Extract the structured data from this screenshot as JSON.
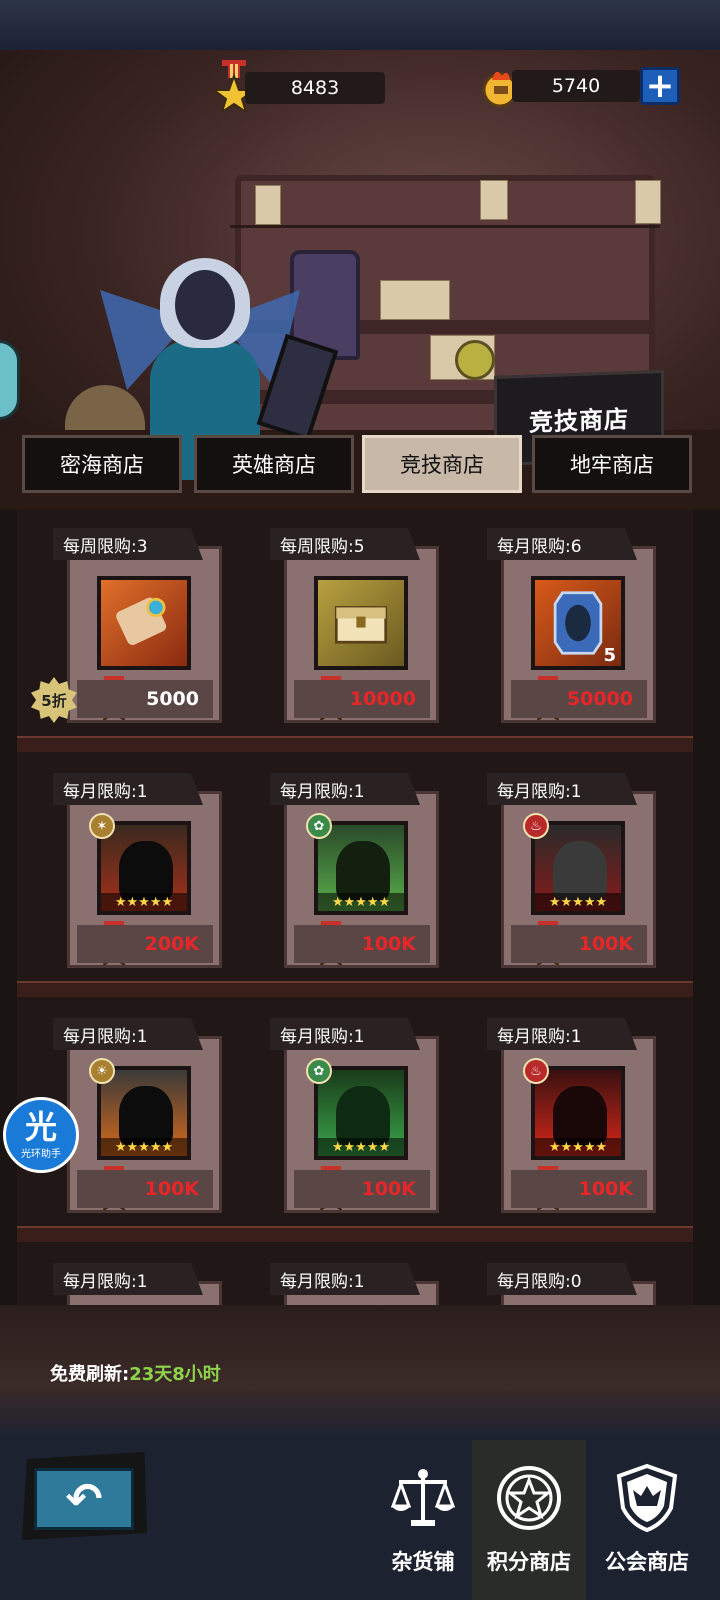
{
  "currency": {
    "medal_amount": "8483",
    "fire_amount": "5740",
    "plus_label": "+"
  },
  "shop_sign": "竞技商店",
  "tabs": [
    {
      "label": "密海商店",
      "active": false
    },
    {
      "label": "英雄商店",
      "active": false
    },
    {
      "label": "竞技商店",
      "active": true
    },
    {
      "label": "地牢商店",
      "active": false
    }
  ],
  "items": [
    {
      "limit": "每周限购:3",
      "price": "5000",
      "price_color": "white",
      "icon": "scroll-icon",
      "discount": "5折"
    },
    {
      "limit": "每周限购:5",
      "price": "10000",
      "price_color": "red",
      "icon": "treasure-chest-icon"
    },
    {
      "limit": "每月限购:6",
      "price": "50000",
      "price_color": "red",
      "icon": "hero-card-icon",
      "qty": "5"
    },
    {
      "limit": "每月限购:1",
      "price": "200K",
      "price_color": "red",
      "icon": "hero-portrait-icon",
      "stars": "★★★★★"
    },
    {
      "limit": "每月限购:1",
      "price": "100K",
      "price_color": "red",
      "icon": "hero-portrait-icon",
      "stars": "★★★★★"
    },
    {
      "limit": "每月限购:1",
      "price": "100K",
      "price_color": "red",
      "icon": "hero-portrait-icon",
      "stars": "★★★★★"
    },
    {
      "limit": "每月限购:1",
      "price": "100K",
      "price_color": "red",
      "icon": "hero-portrait-icon",
      "stars": "★★★★★"
    },
    {
      "limit": "每月限购:1",
      "price": "100K",
      "price_color": "red",
      "icon": "hero-portrait-icon",
      "stars": "★★★★★"
    },
    {
      "limit": "每月限购:1",
      "price": "100K",
      "price_color": "red",
      "icon": "hero-portrait-icon",
      "stars": "★★★★★"
    },
    {
      "limit": "每月限购:1"
    },
    {
      "limit": "每月限购:1"
    },
    {
      "limit": "每月限购:0"
    }
  ],
  "refresh": {
    "label": "免费刷新:",
    "value": "23天8小时"
  },
  "bottom_nav": [
    {
      "label": "杂货铺",
      "icon": "scales-icon",
      "active": false
    },
    {
      "label": "积分商店",
      "icon": "star-emblem-icon",
      "active": true
    },
    {
      "label": "公会商店",
      "icon": "shield-icon",
      "active": false
    }
  ],
  "helper": {
    "big": "光",
    "small": "光环助手"
  },
  "colors": {
    "price_red": "#e8262a",
    "refresh_green": "#8ed34a",
    "tab_active": "#c8b8a8"
  }
}
